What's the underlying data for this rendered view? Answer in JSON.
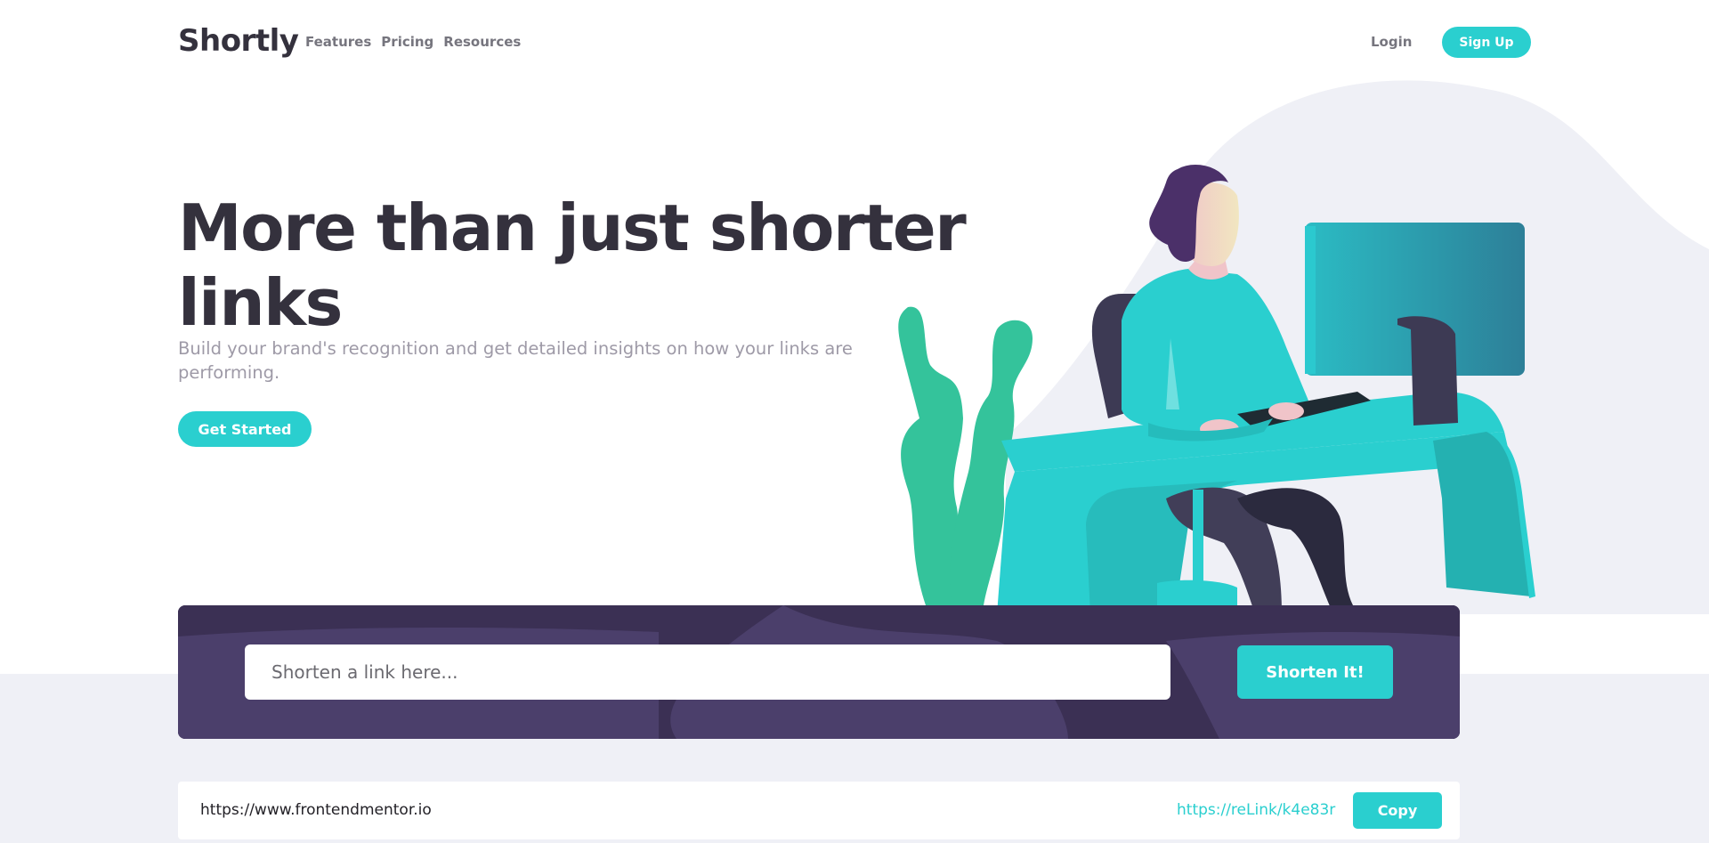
{
  "header": {
    "logo": "Shortly",
    "nav": [
      "Features",
      "Pricing",
      "Resources"
    ],
    "login": "Login",
    "signup": "Sign Up"
  },
  "hero": {
    "title": "More than just shorter links",
    "subtitle": "Build your brand's recognition and get detailed insights on how your links are performing.",
    "cta": "Get Started"
  },
  "shorten": {
    "placeholder": "Shorten a link here...",
    "input_value": "",
    "button": "Shorten It!"
  },
  "results": [
    {
      "original": "https://www.frontendmentor.io",
      "short": "https://reLink/k4e83r",
      "copy": "Copy"
    }
  ],
  "colors": {
    "accent": "#2acfcf",
    "dark_violet": "#3b3054",
    "text_dark": "#34313d",
    "gray_bg": "#eff0f6"
  }
}
